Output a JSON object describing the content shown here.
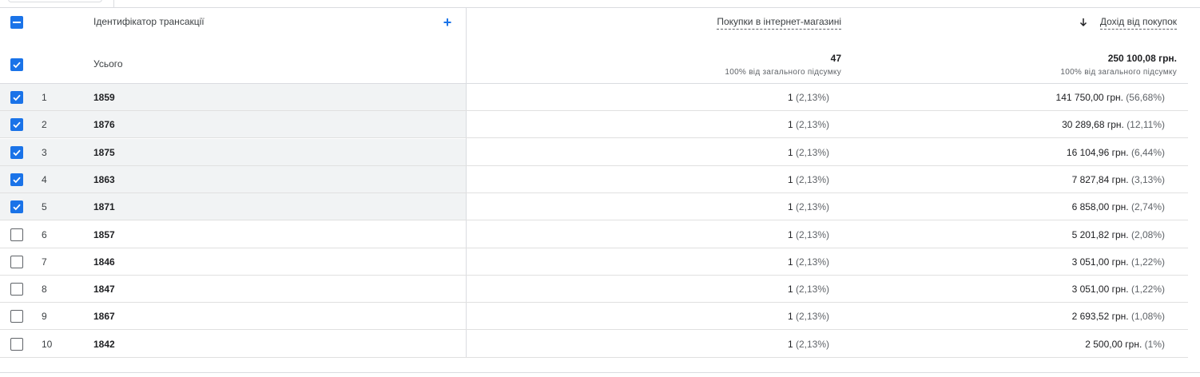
{
  "header": {
    "dimension_label": "Ідентифікатор трансакції",
    "purchases_label": "Покупки в інтернет-магазині",
    "revenue_label": "Дохід від покупок"
  },
  "totals": {
    "label": "Усього",
    "purchases": "47",
    "purchases_sub": "100% від загального підсумку",
    "revenue": "250 100,08 грн.",
    "revenue_sub": "100% від загального підсумку"
  },
  "rows": [
    {
      "index": "1",
      "id": "1859",
      "checked": true,
      "purchases": "1",
      "purchases_pct": "(2,13%)",
      "revenue": "141 750,00 грн.",
      "revenue_pct": "(56,68%)"
    },
    {
      "index": "2",
      "id": "1876",
      "checked": true,
      "purchases": "1",
      "purchases_pct": "(2,13%)",
      "revenue": "30 289,68 грн.",
      "revenue_pct": "(12,11%)"
    },
    {
      "index": "3",
      "id": "1875",
      "checked": true,
      "purchases": "1",
      "purchases_pct": "(2,13%)",
      "revenue": "16 104,96 грн.",
      "revenue_pct": "(6,44%)"
    },
    {
      "index": "4",
      "id": "1863",
      "checked": true,
      "purchases": "1",
      "purchases_pct": "(2,13%)",
      "revenue": "7 827,84 грн.",
      "revenue_pct": "(3,13%)"
    },
    {
      "index": "5",
      "id": "1871",
      "checked": true,
      "purchases": "1",
      "purchases_pct": "(2,13%)",
      "revenue": "6 858,00 грн.",
      "revenue_pct": "(2,74%)"
    },
    {
      "index": "6",
      "id": "1857",
      "checked": false,
      "purchases": "1",
      "purchases_pct": "(2,13%)",
      "revenue": "5 201,82 грн.",
      "revenue_pct": "(2,08%)"
    },
    {
      "index": "7",
      "id": "1846",
      "checked": false,
      "purchases": "1",
      "purchases_pct": "(2,13%)",
      "revenue": "3 051,00 грн.",
      "revenue_pct": "(1,22%)"
    },
    {
      "index": "8",
      "id": "1847",
      "checked": false,
      "purchases": "1",
      "purchases_pct": "(2,13%)",
      "revenue": "3 051,00 грн.",
      "revenue_pct": "(1,22%)"
    },
    {
      "index": "9",
      "id": "1867",
      "checked": false,
      "purchases": "1",
      "purchases_pct": "(2,13%)",
      "revenue": "2 693,52 грн.",
      "revenue_pct": "(1,08%)"
    },
    {
      "index": "10",
      "id": "1842",
      "checked": false,
      "purchases": "1",
      "purchases_pct": "(2,13%)",
      "revenue": "2 500,00 грн.",
      "revenue_pct": "(1%)"
    }
  ],
  "icons": {
    "select_all": "minus-checkbox-icon",
    "add_dimension": "plus-icon",
    "sort": "arrow-down-icon",
    "checked": "checkbox-checked-icon",
    "unchecked": "checkbox-unchecked-icon"
  },
  "colors": {
    "accent": "#1a73e8",
    "selected_row_bg": "#f1f3f4"
  }
}
